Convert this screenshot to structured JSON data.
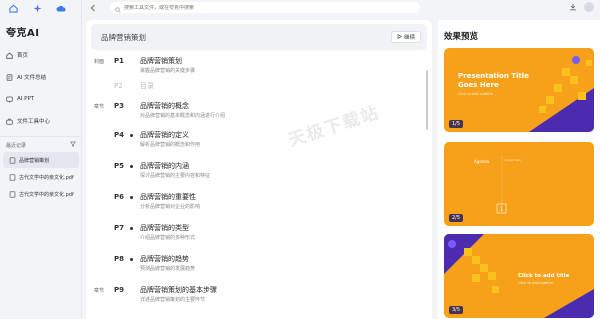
{
  "app": {
    "name": "夸克AI"
  },
  "search": {
    "placeholder": "搜索工具文件，或在夸克中搜索"
  },
  "nav": [
    {
      "label": "首页",
      "icon": "home-icon"
    },
    {
      "label": "AI 文件总结",
      "icon": "file-summary-icon"
    },
    {
      "label": "AI PPT",
      "icon": "ppt-icon"
    },
    {
      "label": "文件工具中心",
      "icon": "toolbox-icon"
    }
  ],
  "history": {
    "heading": "最近记录",
    "items": [
      {
        "label": "品牌营销策划",
        "active": true
      },
      {
        "label": "古代文学中的亲文化.pdf",
        "active": false
      },
      {
        "label": "古代文学中的亲文化.pdf",
        "active": false
      }
    ]
  },
  "outline": {
    "title": "品牌营销策划",
    "continue_label": "继续",
    "rows": [
      {
        "tag": "封面",
        "page": "P1",
        "title": "品牌营销策划",
        "sub": "掌握品牌营销的关键步骤",
        "kind": "cover"
      },
      {
        "tag": "",
        "page": "P2",
        "title": "目录",
        "sub": "",
        "kind": "muted"
      },
      {
        "tag": "章节",
        "page": "P3",
        "title": "品牌营销的概念",
        "sub": "对品牌营销的基本概念和内涵进行介绍",
        "kind": "chapter"
      },
      {
        "tag": "",
        "page": "P4",
        "title": "品牌营销的定义",
        "sub": "解析品牌营销的概念和作用",
        "kind": "item"
      },
      {
        "tag": "",
        "page": "P5",
        "title": "品牌营销的内涵",
        "sub": "探讨品牌营销的主要内容和特征",
        "kind": "item"
      },
      {
        "tag": "",
        "page": "P6",
        "title": "品牌营销的重要性",
        "sub": "分析品牌营销对企业的影响",
        "kind": "item"
      },
      {
        "tag": "",
        "page": "P7",
        "title": "品牌营销的类型",
        "sub": "介绍品牌营销的多种形式",
        "kind": "item"
      },
      {
        "tag": "",
        "page": "P8",
        "title": "品牌营销的趋势",
        "sub": "预测品牌营销的发展趋势",
        "kind": "item"
      },
      {
        "tag": "章节",
        "page": "P9",
        "title": "品牌营销策划的基本步骤",
        "sub": "详述品牌营销策划的主要环节",
        "kind": "chapter"
      }
    ]
  },
  "watermark": "天极下载站",
  "preview": {
    "title": "效果预览",
    "slides": [
      {
        "page": "1/5",
        "title": "Presentation Title Goes Here",
        "sub": "Click to add subtitle"
      },
      {
        "page": "2/5",
        "title": "Agenda",
        "sub": "Content Here"
      },
      {
        "page": "3/5",
        "title": "Click to add title",
        "sub": "Click to add subtitle"
      }
    ]
  },
  "colors": {
    "accent": "#f7a11a",
    "purple": "#4b2bb0",
    "sidebar_bg": "#f3f4f8"
  }
}
